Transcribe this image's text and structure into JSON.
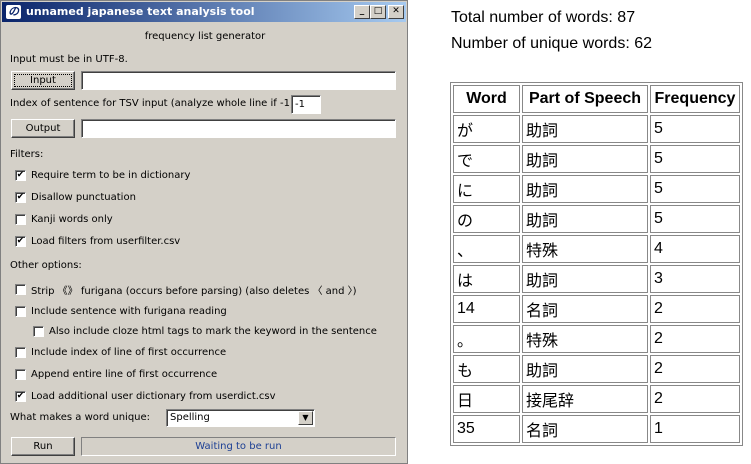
{
  "window": {
    "title": "unnamed japanese text analysis tool",
    "app_icon": "の",
    "controls": {
      "minimize": "_",
      "maximize": "□",
      "close": "✕"
    }
  },
  "form": {
    "subtitle": "frequency list generator",
    "input_note": "Input must be in UTF-8.",
    "input_button": "Input",
    "input_value": "",
    "index_label": "Index of sentence for TSV input (analyze whole line if -1):",
    "index_value": "-1",
    "output_button": "Output",
    "output_value": "",
    "filters_label": "Filters:",
    "filters": [
      {
        "label": "Require term to be in dictionary",
        "checked": true
      },
      {
        "label": "Disallow punctuation",
        "checked": true
      },
      {
        "label": "Kanji words only",
        "checked": false
      },
      {
        "label": "Load filters from userfilter.csv",
        "checked": true
      }
    ],
    "other_label": "Other options:",
    "options": [
      {
        "label": "Strip 《》 furigana (occurs before parsing) (also deletes 〈 and 〉)",
        "checked": false
      },
      {
        "label": "Include sentence with furigana reading",
        "checked": false
      },
      {
        "label": "Also include cloze html tags to mark the keyword in the sentence",
        "checked": false
      },
      {
        "label": "Include index of line of first occurrence",
        "checked": false
      },
      {
        "label": "Append entire line of first occurrence",
        "checked": false
      },
      {
        "label": "Load additional user dictionary from userdict.csv",
        "checked": true
      }
    ],
    "unique_label": "What makes a word unique:",
    "unique_value": "Spelling",
    "run_button": "Run",
    "status": "Waiting to be run"
  },
  "stats": {
    "total_words": "Total number of words: 87",
    "unique_words": "Number of unique words: 62"
  },
  "table": {
    "headers": [
      "Word",
      "Part of Speech",
      "Frequency"
    ],
    "rows": [
      [
        "が",
        "助詞",
        "5"
      ],
      [
        "で",
        "助詞",
        "5"
      ],
      [
        "に",
        "助詞",
        "5"
      ],
      [
        "の",
        "助詞",
        "5"
      ],
      [
        "、",
        "特殊",
        "4"
      ],
      [
        "は",
        "助詞",
        "3"
      ],
      [
        "14",
        "名詞",
        "2"
      ],
      [
        "。",
        "特殊",
        "2"
      ],
      [
        "も",
        "助詞",
        "2"
      ],
      [
        "日",
        "接尾辞",
        "2"
      ],
      [
        "35",
        "名詞",
        "1"
      ]
    ]
  }
}
